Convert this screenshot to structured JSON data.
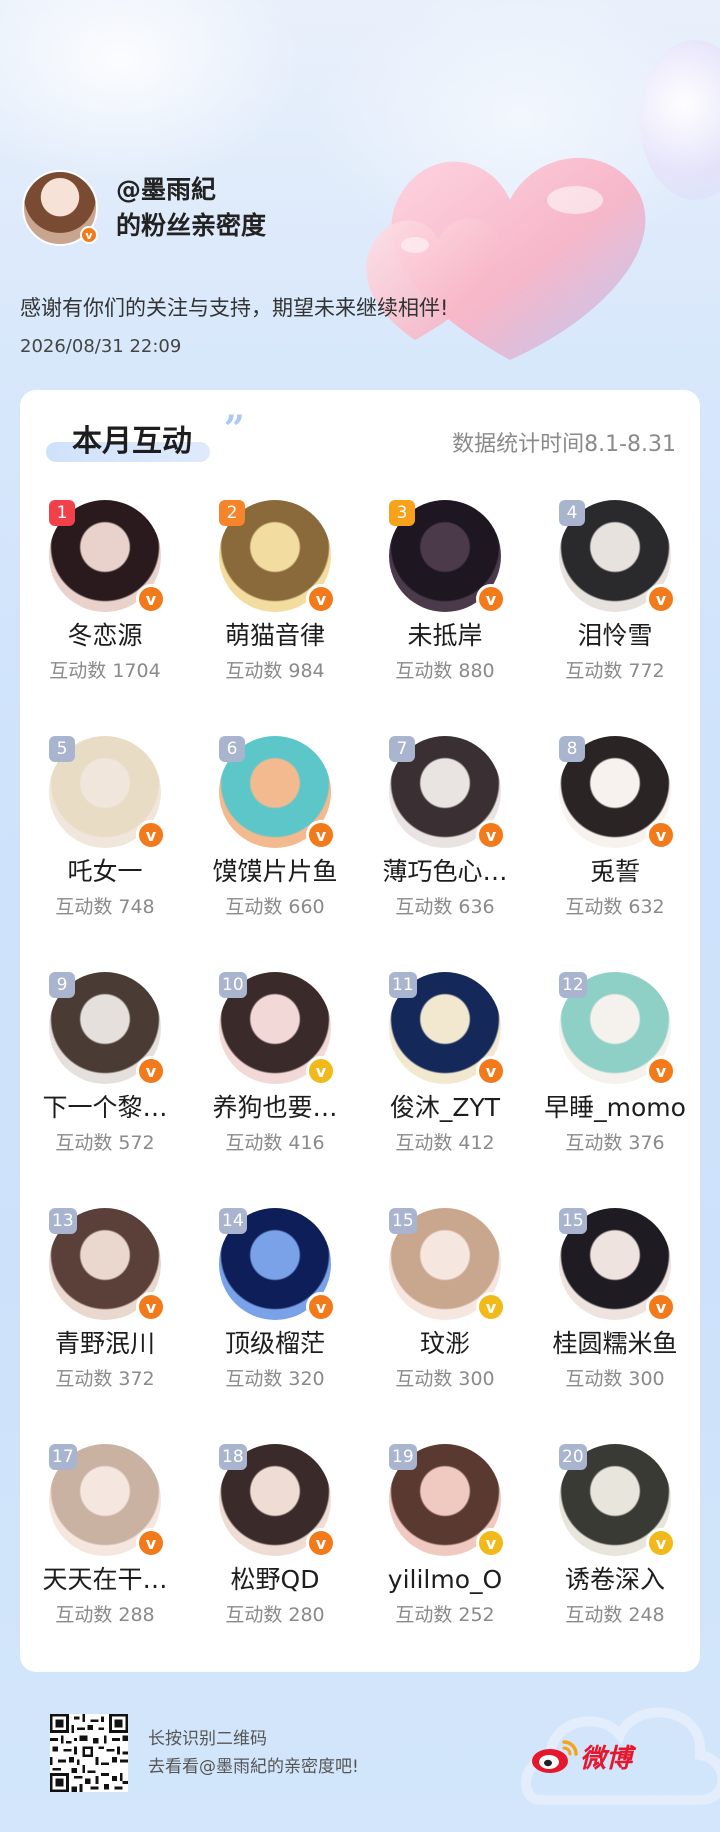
{
  "header": {
    "handle": "@墨雨紀",
    "subtitle": "的粉丝亲密度",
    "thanks": "感谢有你们的关注与支持，期望未来继续相伴!",
    "datetime": "2026/08/31  22:09",
    "verified_mark": "v"
  },
  "card": {
    "title": "本月互动",
    "quote_mark": "”",
    "stat_range": "数据统计时间8.1-8.31"
  },
  "fans": [
    {
      "rank": "1",
      "name": "冬恋源",
      "count": "互动数 1704",
      "badge": "#f27a1a",
      "avatar": [
        "#e9d2cc",
        "#2a1a1e"
      ]
    },
    {
      "rank": "2",
      "name": "萌猫音律",
      "count": "互动数 984",
      "badge": "#f27a1a",
      "avatar": [
        "#f3dca0",
        "#8a6a3a"
      ]
    },
    {
      "rank": "3",
      "name": "未抵岸",
      "count": "互动数 880",
      "badge": "#f27a1a",
      "avatar": [
        "#4a3a4a",
        "#1e1620"
      ]
    },
    {
      "rank": "4",
      "name": "泪怜雪",
      "count": "互动数 772",
      "badge": "#f27a1a",
      "avatar": [
        "#e8e2df",
        "#2a2a2c"
      ]
    },
    {
      "rank": "5",
      "name": "吒女一",
      "count": "互动数 748",
      "badge": "#f27a1a",
      "avatar": [
        "#f1e6dc",
        "#e9dcc4"
      ]
    },
    {
      "rank": "6",
      "name": "馍馍片片鱼",
      "count": "互动数 660",
      "badge": "#f27a1a",
      "avatar": [
        "#f3b98f",
        "#5cc6c9"
      ]
    },
    {
      "rank": "7",
      "name": "薄巧色心…",
      "count": "互动数 636",
      "badge": "#f27a1a",
      "avatar": [
        "#e9e4e2",
        "#3a3034"
      ]
    },
    {
      "rank": "8",
      "name": "兎誓",
      "count": "互动数 632",
      "badge": "#f27a1a",
      "avatar": [
        "#f7f2ee",
        "#2a2424"
      ]
    },
    {
      "rank": "9",
      "name": "下一个黎…",
      "count": "互动数 572",
      "badge": "#f27a1a",
      "avatar": [
        "#e6e0dc",
        "#4a3c34"
      ]
    },
    {
      "rank": "10",
      "name": "养狗也要…",
      "count": "互动数 416",
      "badge": "#f2b91a",
      "avatar": [
        "#f2d8d6",
        "#3a2a2a"
      ]
    },
    {
      "rank": "11",
      "name": "俊沐_ZYT",
      "count": "互动数 412",
      "badge": "#f27a1a",
      "avatar": [
        "#f2e8d0",
        "#14285a"
      ]
    },
    {
      "rank": "12",
      "name": "早睡_momo",
      "count": "互动数 376",
      "badge": "#f27a1a",
      "avatar": [
        "#f5f1ec",
        "#8ed0c6"
      ]
    },
    {
      "rank": "13",
      "name": "青野泯川",
      "count": "互动数 372",
      "badge": "#f27a1a",
      "avatar": [
        "#ead7cd",
        "#5a4038"
      ]
    },
    {
      "rank": "14",
      "name": "顶级榴茫",
      "count": "互动数 320",
      "badge": "#f27a1a",
      "avatar": [
        "#7aa2e8",
        "#0e1e58"
      ]
    },
    {
      "rank": "15",
      "name": "玟浵",
      "count": "互动数 300",
      "badge": "#f2b91a",
      "avatar": [
        "#f5e6df",
        "#c9a68e"
      ]
    },
    {
      "rank": "15",
      "name": "桂圆糯米鱼",
      "count": "互动数 300",
      "badge": "#f27a1a",
      "avatar": [
        "#eee3de",
        "#1e1c22"
      ]
    },
    {
      "rank": "17",
      "name": "天天在干…",
      "count": "互动数 288",
      "badge": "#f27a1a",
      "avatar": [
        "#f6e6e0",
        "#c9b2a2"
      ]
    },
    {
      "rank": "18",
      "name": "松野QD",
      "count": "互动数 280",
      "badge": "#f27a1a",
      "avatar": [
        "#efdcd4",
        "#3a2a2a"
      ]
    },
    {
      "rank": "19",
      "name": "yililmo_O",
      "count": "互动数 252",
      "badge": "#f2b91a",
      "avatar": [
        "#f0c9c0",
        "#5a3a30"
      ]
    },
    {
      "rank": "20",
      "name": "诱卷深入",
      "count": "互动数 248",
      "badge": "#f2b91a",
      "avatar": [
        "#e8e6dc",
        "#3a3a34"
      ]
    }
  ],
  "footer": {
    "line1": "长按识别二维码",
    "line2": "去看看@墨雨紀的亲密度吧!",
    "brand": "微博"
  },
  "colors": {
    "rank_top1": "#f2404a",
    "rank_top2": "#f7842a",
    "rank_top3": "#f7a21a",
    "rank_other": "#a9b4cf",
    "verified_orange": "#f27a1a",
    "verified_gold": "#f2b91a",
    "weibo_red": "#e6162d"
  },
  "icons": {
    "verified": "verified-v-icon",
    "qr": "qr-code-icon",
    "brand_logo": "weibo-eye-logo"
  }
}
